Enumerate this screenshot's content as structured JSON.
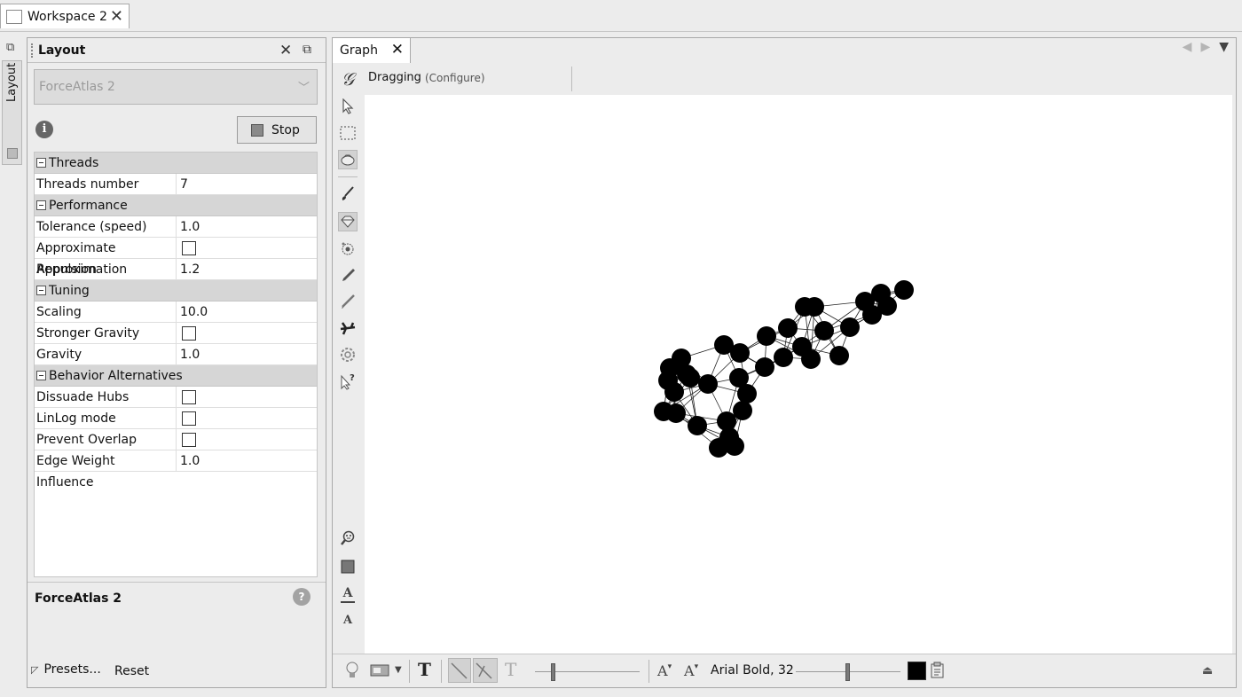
{
  "workspace": {
    "tab_label": "Workspace 2"
  },
  "side_strip": {
    "tab_label": "Layout"
  },
  "layout_panel": {
    "title": "Layout",
    "algorithm": "ForceAtlas 2",
    "stop_label": "Stop",
    "sections": [
      {
        "title": "Threads",
        "rows": [
          {
            "name": "Threads number",
            "value": "7"
          }
        ]
      },
      {
        "title": "Performance",
        "rows": [
          {
            "name": "Tolerance (speed)",
            "value": "1.0"
          },
          {
            "name": "Approximate Repulsion",
            "checkbox": true,
            "checked": false
          },
          {
            "name": "Approximation",
            "value": "1.2"
          }
        ]
      },
      {
        "title": "Tuning",
        "rows": [
          {
            "name": "Scaling",
            "value": "10.0"
          },
          {
            "name": "Stronger Gravity",
            "checkbox": true,
            "checked": false
          },
          {
            "name": "Gravity",
            "value": "1.0"
          }
        ]
      },
      {
        "title": "Behavior Alternatives",
        "rows": [
          {
            "name": "Dissuade Hubs",
            "checkbox": true,
            "checked": false
          },
          {
            "name": "LinLog mode",
            "checkbox": true,
            "checked": false
          },
          {
            "name": "Prevent Overlap",
            "checkbox": true,
            "checked": false
          },
          {
            "name": "Edge Weight Influence",
            "value": "1.0"
          }
        ]
      }
    ],
    "description_title": "ForceAtlas 2",
    "presets_label": "Presets...",
    "reset_label": "Reset"
  },
  "graph_panel": {
    "tab_label": "Graph",
    "mode_label": "Dragging",
    "configure_label": "(Configure)",
    "font_label": "Arial Bold, 32",
    "node_color": "#000000"
  },
  "icons": {
    "left_toolbar": [
      "gephi-logo-icon",
      "pointer-icon",
      "rectangle-select-icon",
      "drag-hand-icon",
      "painter-icon",
      "diamond-icon",
      "heat-map-icon",
      "pencil-icon",
      "edge-pencil-icon",
      "shortest-path-icon",
      "settings-gear-icon",
      "help-pointer-icon",
      "zoom-fit-icon",
      "background-color-icon",
      "text-color-icon",
      "text-size-icon"
    ],
    "bottom_toolbar": [
      "lightbulb-icon",
      "screenshot-icon",
      "text-bold-icon",
      "edge-mode-icon",
      "edge-arrow-icon",
      "text-outline-icon",
      "font-smaller-icon",
      "font-larger-icon",
      "clipboard-icon",
      "eject-icon"
    ]
  }
}
